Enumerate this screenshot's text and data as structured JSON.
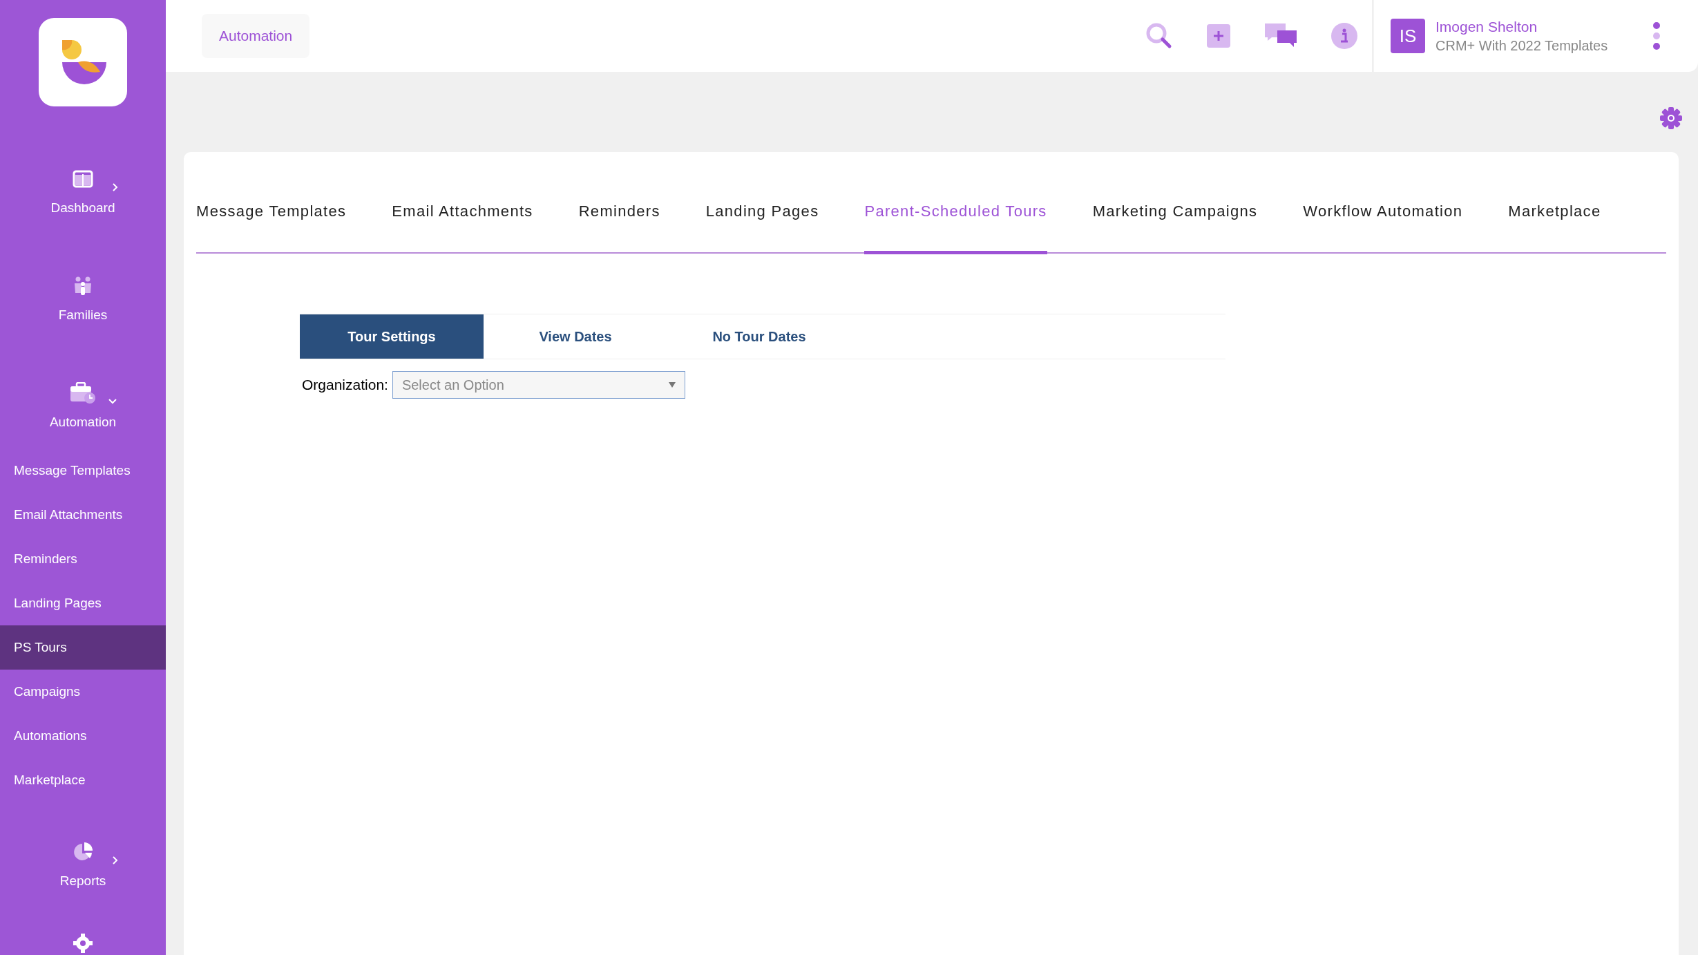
{
  "breadcrumb": "Automation",
  "sidebar": {
    "groups": [
      {
        "label": "Dashboard",
        "expanded": false
      },
      {
        "label": "Families"
      },
      {
        "label": "Automation",
        "expanded": true,
        "children": [
          {
            "label": "Message Templates",
            "selected": false
          },
          {
            "label": "Email Attachments",
            "selected": false
          },
          {
            "label": "Reminders",
            "selected": false
          },
          {
            "label": "Landing Pages",
            "selected": false
          },
          {
            "label": "PS Tours",
            "selected": true
          },
          {
            "label": "Campaigns",
            "selected": false
          },
          {
            "label": "Automations",
            "selected": false
          },
          {
            "label": "Marketplace",
            "selected": false
          }
        ]
      },
      {
        "label": "Reports",
        "expanded": false
      }
    ]
  },
  "user": {
    "initials": "IS",
    "name": "Imogen Shelton",
    "plan": "CRM+ With 2022 Templates"
  },
  "tabs": [
    {
      "label": "Message Templates",
      "selected": false
    },
    {
      "label": "Email Attachments",
      "selected": false
    },
    {
      "label": "Reminders",
      "selected": false
    },
    {
      "label": "Landing Pages",
      "selected": false
    },
    {
      "label": "Parent-Scheduled Tours",
      "selected": true
    },
    {
      "label": "Marketing Campaigns",
      "selected": false
    },
    {
      "label": "Workflow Automation",
      "selected": false
    },
    {
      "label": "Marketplace",
      "selected": false
    }
  ],
  "subtabs": [
    {
      "label": "Tour Settings",
      "selected": true
    },
    {
      "label": "View Dates",
      "selected": false
    },
    {
      "label": "No Tour Dates",
      "selected": false
    }
  ],
  "organization": {
    "label": "Organization:",
    "placeholder": "Select an Option"
  }
}
